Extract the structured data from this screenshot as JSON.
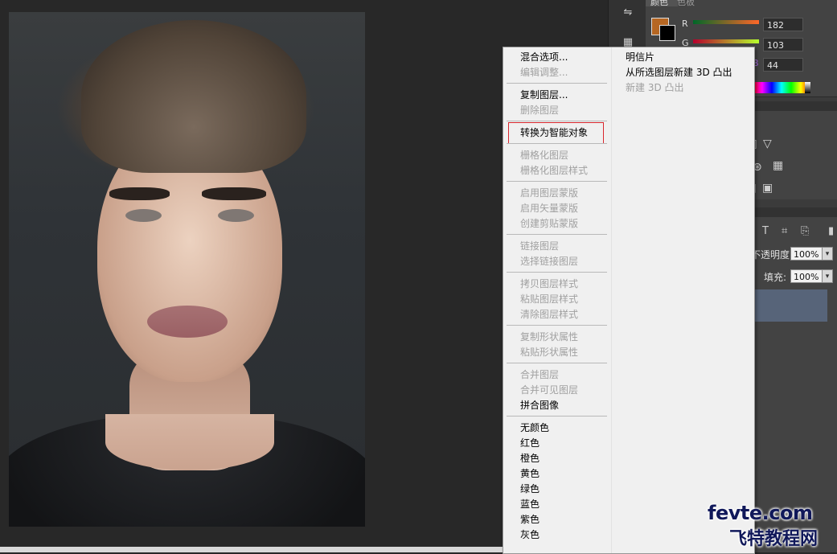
{
  "color_panel": {
    "tab_color": "颜色",
    "tab_swatch": "色板",
    "fg_color": "#b66723",
    "bg_color": "#000000",
    "channels": [
      {
        "label": "R",
        "value": "182"
      },
      {
        "label": "G",
        "value": "103"
      },
      {
        "label": "B",
        "value": "44"
      }
    ]
  },
  "layers_panel": {
    "opacity_label": "不透明度:",
    "opacity_value": "100%",
    "fill_label": "填充:",
    "fill_value": "100%"
  },
  "context_menu": {
    "left_items": [
      {
        "label": "混合选项...",
        "enabled": true
      },
      {
        "label": "编辑调整...",
        "enabled": false
      },
      {
        "label": "复制图层...",
        "enabled": true
      },
      {
        "label": "删除图层",
        "enabled": false
      },
      {
        "label": "转换为智能对象",
        "enabled": true,
        "highlighted": true
      },
      {
        "label": "栅格化图层",
        "enabled": false
      },
      {
        "label": "栅格化图层样式",
        "enabled": false
      },
      {
        "label": "启用图层蒙版",
        "enabled": false
      },
      {
        "label": "启用矢量蒙版",
        "enabled": false
      },
      {
        "label": "创建剪贴蒙版",
        "enabled": false
      },
      {
        "label": "链接图层",
        "enabled": false
      },
      {
        "label": "选择链接图层",
        "enabled": false
      },
      {
        "label": "拷贝图层样式",
        "enabled": false
      },
      {
        "label": "粘贴图层样式",
        "enabled": false
      },
      {
        "label": "清除图层样式",
        "enabled": false
      },
      {
        "label": "复制形状属性",
        "enabled": false
      },
      {
        "label": "粘贴形状属性",
        "enabled": false
      },
      {
        "label": "合并图层",
        "enabled": false
      },
      {
        "label": "合并可见图层",
        "enabled": false
      },
      {
        "label": "拼合图像",
        "enabled": true
      },
      {
        "label": "无颜色",
        "enabled": true
      },
      {
        "label": "红色",
        "enabled": true
      },
      {
        "label": "橙色",
        "enabled": true
      },
      {
        "label": "黄色",
        "enabled": true
      },
      {
        "label": "绿色",
        "enabled": true
      },
      {
        "label": "蓝色",
        "enabled": true
      },
      {
        "label": "紫色",
        "enabled": true
      },
      {
        "label": "灰色",
        "enabled": true
      }
    ],
    "right_items": [
      {
        "label": "明信片",
        "enabled": true
      },
      {
        "label": "从所选图层新建 3D 凸出",
        "enabled": true
      },
      {
        "label": "新建 3D 凸出",
        "enabled": false
      }
    ]
  },
  "watermark": {
    "line1": "fevte.com",
    "line2": "飞特教程网"
  }
}
